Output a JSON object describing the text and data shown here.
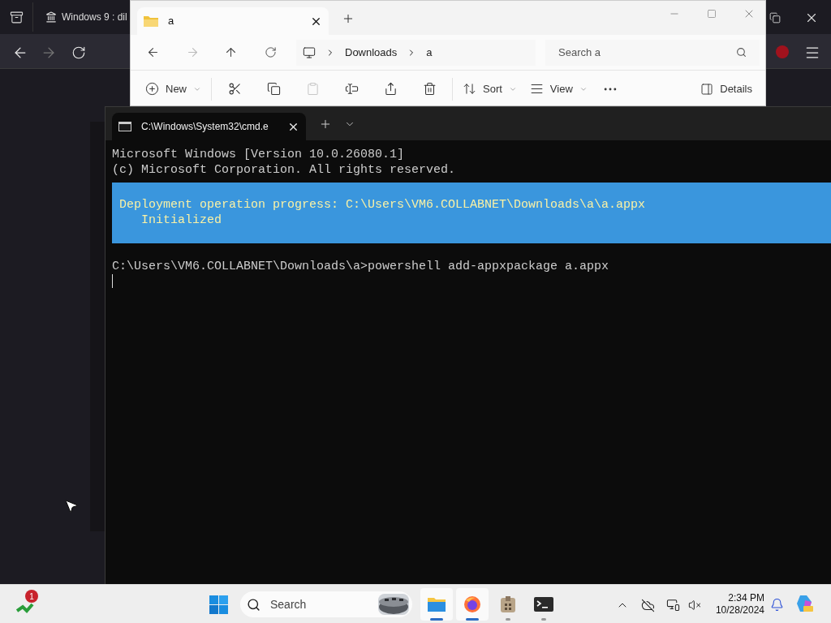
{
  "browser": {
    "tab_title": "Windows 9 : dil"
  },
  "explorer": {
    "tab_title": "a",
    "breadcrumb": [
      "Downloads",
      "a"
    ],
    "search": {
      "placeholder": "Search a"
    },
    "toolbar": [
      {
        "kind": "labeled",
        "label": "New",
        "disabled": false
      },
      {
        "kind": "icon",
        "disabled": false
      },
      {
        "kind": "icon",
        "disabled": false
      },
      {
        "kind": "icon",
        "disabled": true
      },
      {
        "kind": "icon",
        "disabled": false
      },
      {
        "kind": "icon",
        "disabled": false
      },
      {
        "kind": "icon",
        "disabled": false
      },
      {
        "kind": "labeled",
        "label": "Sort",
        "disabled": false
      },
      {
        "kind": "labeled",
        "label": "View",
        "disabled": false
      },
      {
        "kind": "more",
        "disabled": false
      }
    ],
    "details_label": "Details"
  },
  "terminal": {
    "tab_title": "C:\\Windows\\System32\\cmd.e",
    "lines": [
      {
        "kind": "plain",
        "text": "Microsoft Windows [Version 10.0.26080.1]"
      },
      {
        "kind": "plain",
        "text": "(c) Microsoft Corporation. All rights reserved."
      },
      {
        "kind": "progress",
        "text": "Deployment operation progress: C:\\Users\\VM6.COLLABNET\\Downloads\\a\\a.appx",
        "status": "Initialized"
      },
      {
        "kind": "plain",
        "text": "C:\\Users\\VM6.COLLABNET\\Downloads\\a>powershell add-appxpackage a.appx"
      }
    ]
  },
  "taskbar": {
    "widget_badge": "1",
    "search": {
      "placeholder": "Search"
    },
    "apps": [
      {
        "kind": "explorer",
        "active": true
      },
      {
        "kind": "browser",
        "active": true
      },
      {
        "kind": "package",
        "active": false
      },
      {
        "kind": "terminal",
        "active": false
      }
    ],
    "time": "2:34 PM",
    "date": "10/28/2024"
  }
}
